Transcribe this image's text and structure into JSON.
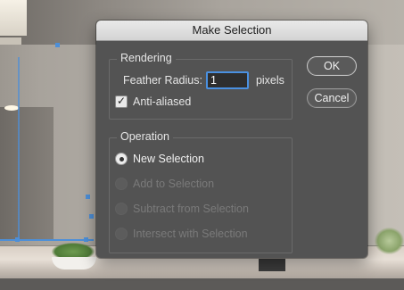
{
  "dialog": {
    "title": "Make Selection",
    "rendering": {
      "group_label": "Rendering",
      "feather_label": "Feather Radius:",
      "feather_value": "1",
      "feather_unit": "pixels",
      "anti_aliased_label": "Anti-aliased",
      "anti_aliased_checked": true
    },
    "operation": {
      "group_label": "Operation",
      "options": [
        {
          "label": "New Selection",
          "selected": true,
          "enabled": true
        },
        {
          "label": "Add to Selection",
          "selected": false,
          "enabled": false
        },
        {
          "label": "Subtract from Selection",
          "selected": false,
          "enabled": false
        },
        {
          "label": "Intersect with Selection",
          "selected": false,
          "enabled": false
        }
      ]
    },
    "buttons": {
      "ok_label": "OK",
      "cancel_label": "Cancel"
    }
  },
  "colors": {
    "dialog_bg": "#535353",
    "titlebar_bg": "#d9d9d9",
    "focus_ring": "#4a90e0",
    "selection_path": "#4d8fd8"
  }
}
